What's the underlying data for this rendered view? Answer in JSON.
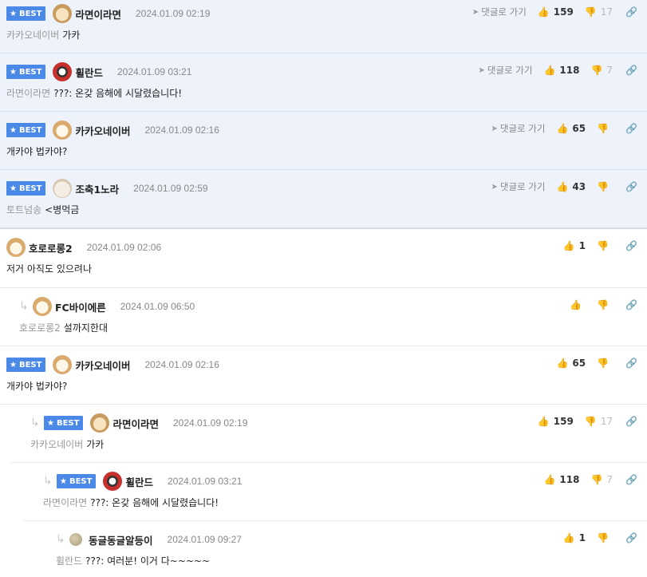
{
  "best_comments": [
    {
      "badge": "BEST",
      "avatar": "dog-avatar",
      "nick": "라면이라면",
      "date": "2024.01.09 02:19",
      "goto": "댓글로 가기",
      "likes": "159",
      "dislikes": "17",
      "mention": "카카오네이버",
      "text": "가카"
    },
    {
      "badge": "BEST",
      "avatar": "owl-avatar",
      "nick": "휠란드",
      "date": "2024.01.09 03:21",
      "goto": "댓글로 가기",
      "likes": "118",
      "dislikes": "7",
      "mention": "라면이라면",
      "text": "???: 온갖 음해에 시달렸습니다!"
    },
    {
      "badge": "BEST",
      "avatar": "fox-avatar",
      "nick": "카카오네이버",
      "date": "2024.01.09 02:16",
      "goto": "댓글로 가기",
      "likes": "65",
      "dislikes": "",
      "mention": "",
      "text": "개카야 법카야?"
    },
    {
      "badge": "BEST",
      "avatar": "puppy-avatar",
      "nick": "조축1노라",
      "date": "2024.01.09 02:59",
      "goto": "댓글로 가기",
      "likes": "43",
      "dislikes": "",
      "mention": "토트넘송",
      "text": "<병먹금"
    }
  ],
  "comments": [
    {
      "nick": "호로로롱2",
      "date": "2024.01.09 02:06",
      "likes": "1",
      "text": "저거 아직도 있으려나"
    },
    {
      "nick": "FC바이에른",
      "date": "2024.01.09 06:50",
      "likes": "",
      "mention": "호로로롱2",
      "text": "설까지한대"
    },
    {
      "badge": "BEST",
      "nick": "카카오네이버",
      "date": "2024.01.09 02:16",
      "likes": "65",
      "text": "개카야 법카야?"
    },
    {
      "badge": "BEST",
      "nick": "라면이라면",
      "date": "2024.01.09 02:19",
      "likes": "159",
      "dislikes": "17",
      "mention": "카카오네이버",
      "text": "가카"
    },
    {
      "badge": "BEST",
      "nick": "휠란드",
      "date": "2024.01.09 03:21",
      "likes": "118",
      "dislikes": "7",
      "mention": "라면이라면",
      "text": "???: 온갖 음해에 시달렸습니다!"
    },
    {
      "nick": "동글동글알등이",
      "date": "2024.01.09 09:27",
      "likes": "1",
      "mention": "휠란드",
      "text": "???: 여러분! 이거 다~~~~~"
    }
  ],
  "icons": {
    "star": "★",
    "thumb_up": "👍",
    "thumb_down": "👎",
    "link": "🔗",
    "plane": "➤",
    "reply": "↳"
  },
  "colors": {
    "best_badge": "#4a89e8",
    "best_bg": "#eef3fb"
  }
}
